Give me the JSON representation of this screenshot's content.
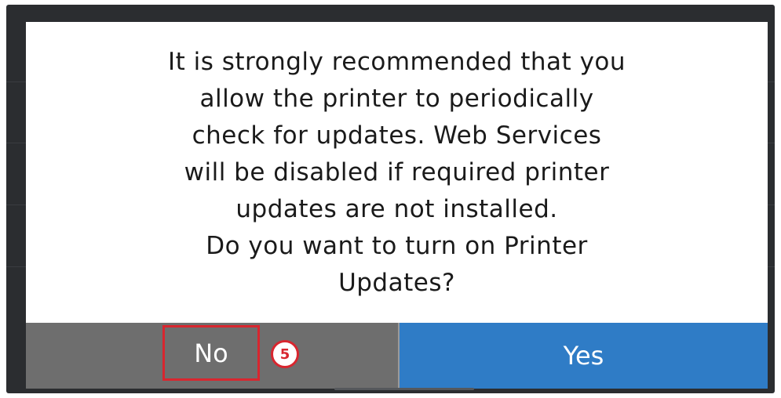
{
  "dialog": {
    "message_lines": [
      "It is strongly recommended that you",
      "allow the printer to periodically",
      "check for updates. Web Services",
      "will be disabled if required printer",
      "updates are not installed.",
      "Do you want to turn on Printer",
      "Updates?"
    ],
    "no_label": "No",
    "yes_label": "Yes"
  },
  "annotation": {
    "step_number": "5"
  },
  "colors": {
    "no_button": "#6e6e6e",
    "yes_button": "#2f7cc6",
    "highlight": "#d8262f",
    "screen_bg": "#2b2d30"
  }
}
